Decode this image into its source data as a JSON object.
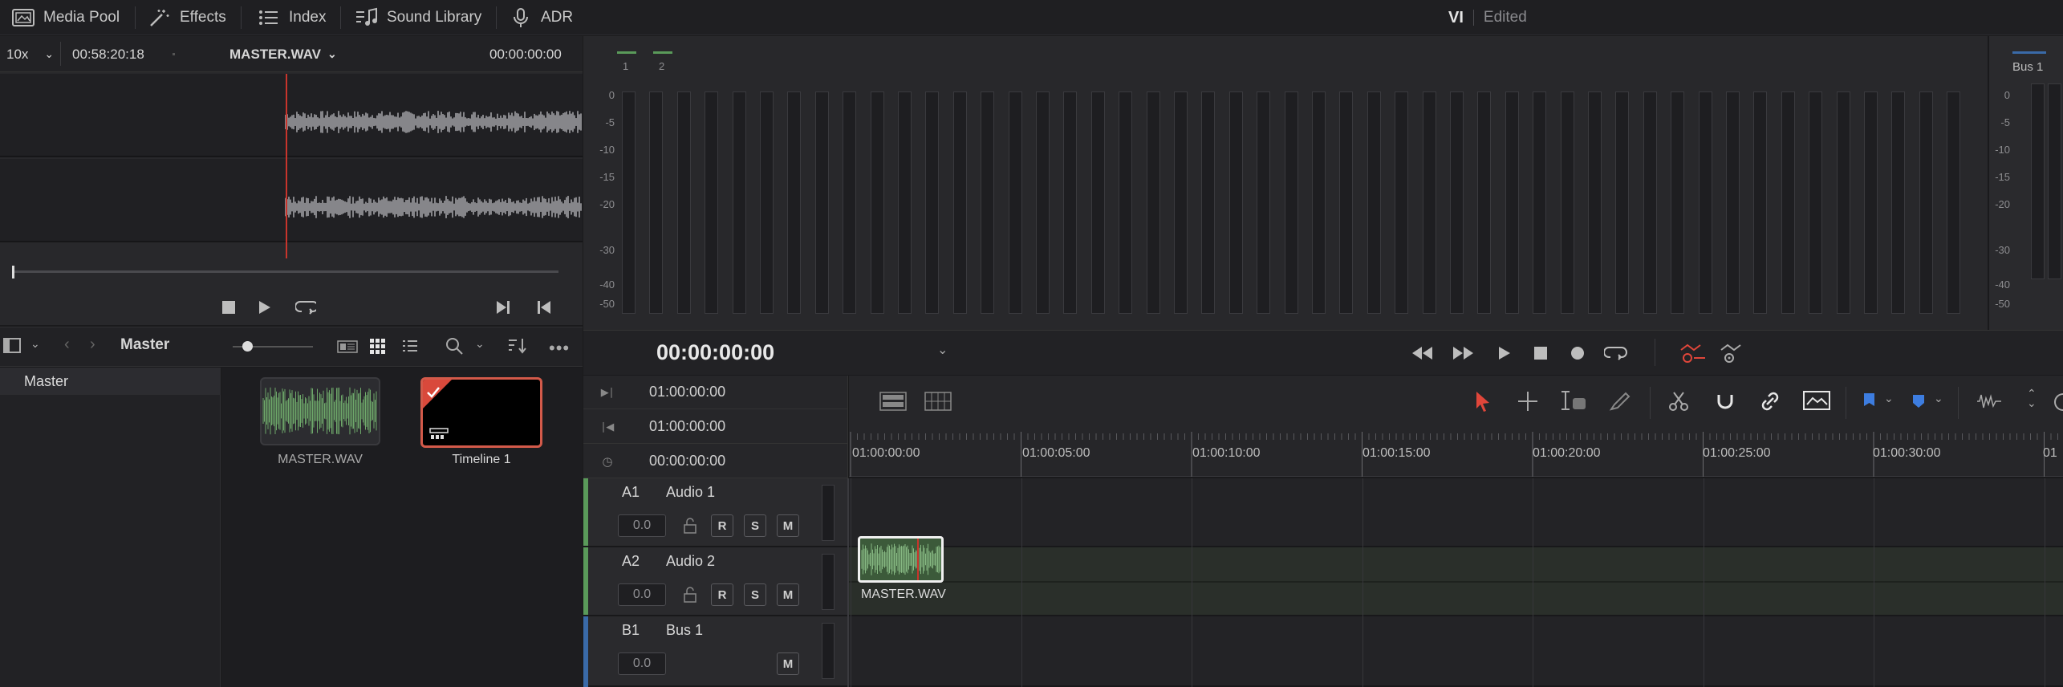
{
  "topbar": {
    "media_pool": "Media Pool",
    "effects": "Effects",
    "index": "Index",
    "sound_library": "Sound Library",
    "adr": "ADR",
    "project_title": "VI",
    "status": "Edited"
  },
  "viewer": {
    "zoom": "10x",
    "duration": "00:58:20:18",
    "clip_name": "MASTER.WAV",
    "timecode": "00:00:00:00"
  },
  "pool": {
    "bin": "Master",
    "bins": [
      {
        "label": "Master"
      }
    ],
    "clips": [
      {
        "name": "MASTER.WAV"
      },
      {
        "name": "Timeline 1"
      }
    ]
  },
  "meters": {
    "channel_labels": [
      "1",
      "2"
    ],
    "scale": [
      "0",
      "-5",
      "-10",
      "-15",
      "-20",
      "-30",
      "-40",
      "-50"
    ],
    "bus_label": "Bus 1"
  },
  "transport": {
    "timecode": "00:00:00:00"
  },
  "timecodes": {
    "in": "01:00:00:00",
    "out": "01:00:00:00",
    "duration": "00:00:00:00"
  },
  "ruler": {
    "labels": [
      "01:00:00:00",
      "01:00:05:00",
      "01:00:10:00",
      "01:00:15:00",
      "01:00:20:00",
      "01:00:25:00",
      "01:00:30:00",
      "01"
    ]
  },
  "tracks": [
    {
      "id": "A1",
      "name": "Audio 1",
      "volume": "0.0",
      "r": "R",
      "s": "S",
      "m": "M"
    },
    {
      "id": "A2",
      "name": "Audio 2",
      "volume": "0.0",
      "r": "R",
      "s": "S",
      "m": "M"
    },
    {
      "id": "B1",
      "name": "Bus 1",
      "volume": "0.0",
      "m": "M"
    }
  ],
  "timeline_clip": {
    "name": "MASTER.WAV"
  },
  "colors": {
    "accent_red": "#e0463a",
    "track_green": "#5a9a5a",
    "bus_blue": "#3a6aa8",
    "wave_green": "#6ea86a"
  }
}
